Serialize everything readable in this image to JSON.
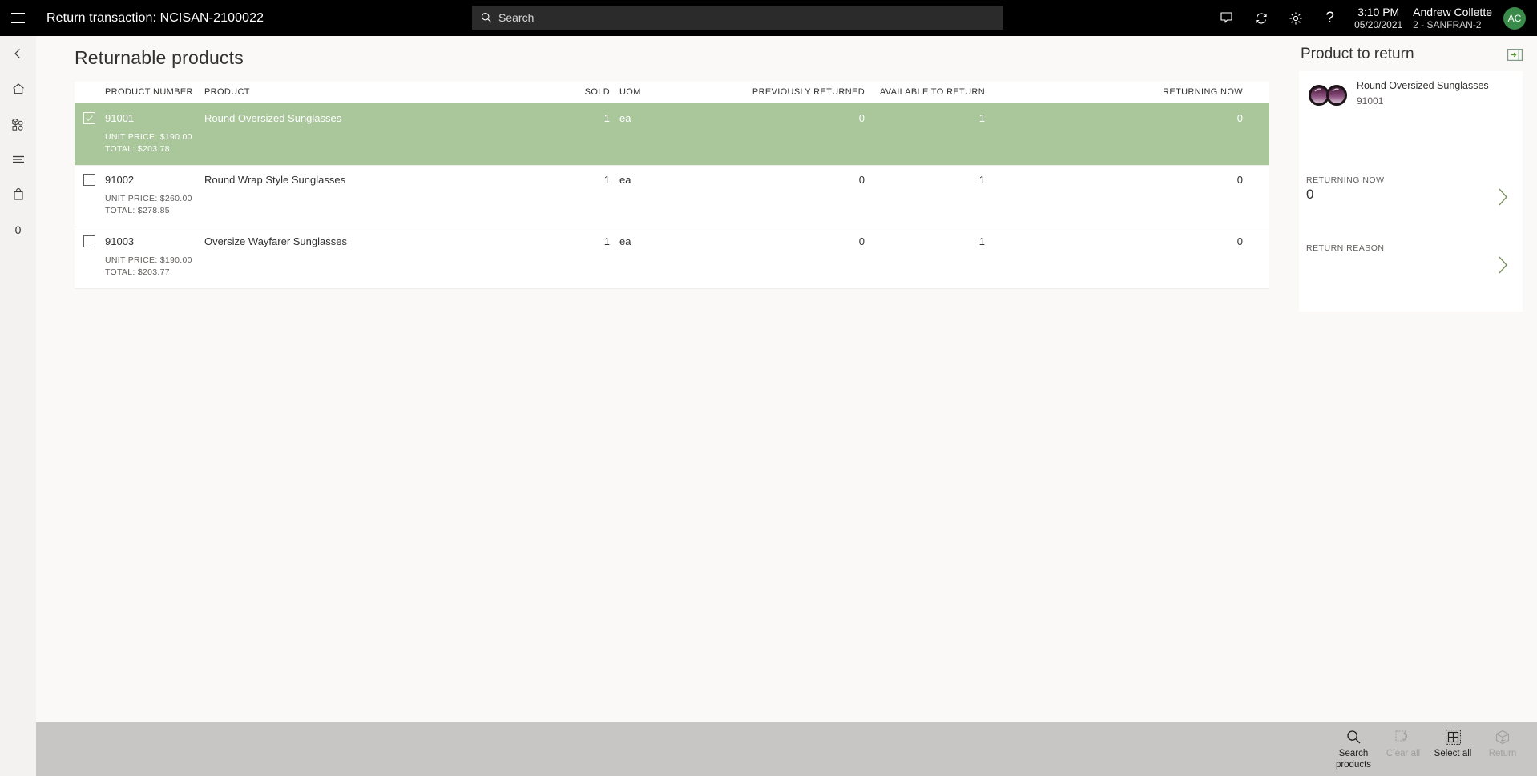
{
  "topbar": {
    "menu_icon": "hamburger-icon",
    "title": "Return transaction: NCISAN-2100022",
    "search_placeholder": "Search",
    "search_value": "",
    "icons": [
      "feedback-icon",
      "sync-icon",
      "settings-gear-icon",
      "help-question-icon"
    ],
    "time": "3:10 PM",
    "date": "05/20/2021",
    "user_name": "Andrew Collette",
    "user_store": "2 - SANFRAN-2",
    "avatar_initials": "AC",
    "avatar_color": "#3a8a4a"
  },
  "rail": {
    "items": [
      {
        "name": "back-arrow-icon",
        "label": ""
      },
      {
        "name": "home-icon",
        "label": ""
      },
      {
        "name": "products-cube-icon",
        "label": ""
      },
      {
        "name": "list-lines-icon",
        "label": ""
      },
      {
        "name": "shopping-bag-icon",
        "label": ""
      },
      {
        "name": "cart-count",
        "label": "0"
      }
    ]
  },
  "main": {
    "page_title": "Returnable products",
    "columns": [
      "PRODUCT NUMBER",
      "PRODUCT",
      "SOLD",
      "UOM",
      "PREVIOUSLY RETURNED",
      "AVAILABLE TO RETURN",
      "RETURNING NOW"
    ],
    "rows": [
      {
        "selected": true,
        "checked": true,
        "product_number": "91001",
        "product": "Round Oversized Sunglasses",
        "sold": "1",
        "uom": "ea",
        "previously_returned": "0",
        "available_to_return": "1",
        "returning_now": "0",
        "unit_price": "UNIT PRICE: $190.00",
        "total": "TOTAL: $203.78"
      },
      {
        "selected": false,
        "checked": false,
        "product_number": "91002",
        "product": "Round Wrap Style Sunglasses",
        "sold": "1",
        "uom": "ea",
        "previously_returned": "0",
        "available_to_return": "1",
        "returning_now": "0",
        "unit_price": "UNIT PRICE: $260.00",
        "total": "TOTAL: $278.85"
      },
      {
        "selected": false,
        "checked": false,
        "product_number": "91003",
        "product": "Oversize Wayfarer Sunglasses",
        "sold": "1",
        "uom": "ea",
        "previously_returned": "0",
        "available_to_return": "1",
        "returning_now": "0",
        "unit_price": "UNIT PRICE: $190.00",
        "total": "TOTAL: $203.77"
      }
    ],
    "selected_row_color": "#a9c79a"
  },
  "right_panel": {
    "title": "Product to return",
    "expand_icon": "expand-panel-icon",
    "product": {
      "image": "round-oversized-sunglasses-thumbnail",
      "name": "Round Oversized Sunglasses",
      "number": "91001"
    },
    "fields": [
      {
        "label": "RETURNING NOW",
        "value": "0",
        "chevron": "chevron-right-icon"
      },
      {
        "label": "RETURN REASON",
        "value": "",
        "chevron": "chevron-right-icon"
      }
    ]
  },
  "bottombar": {
    "buttons": [
      {
        "icon": "search-magnifier-icon",
        "label": "Search products",
        "disabled": false
      },
      {
        "icon": "clear-all-icon",
        "label": "Clear all",
        "disabled": true
      },
      {
        "icon": "select-all-grid-icon",
        "label": "Select all",
        "disabled": false
      },
      {
        "icon": "return-box-icon",
        "label": "Return",
        "disabled": true
      }
    ]
  }
}
